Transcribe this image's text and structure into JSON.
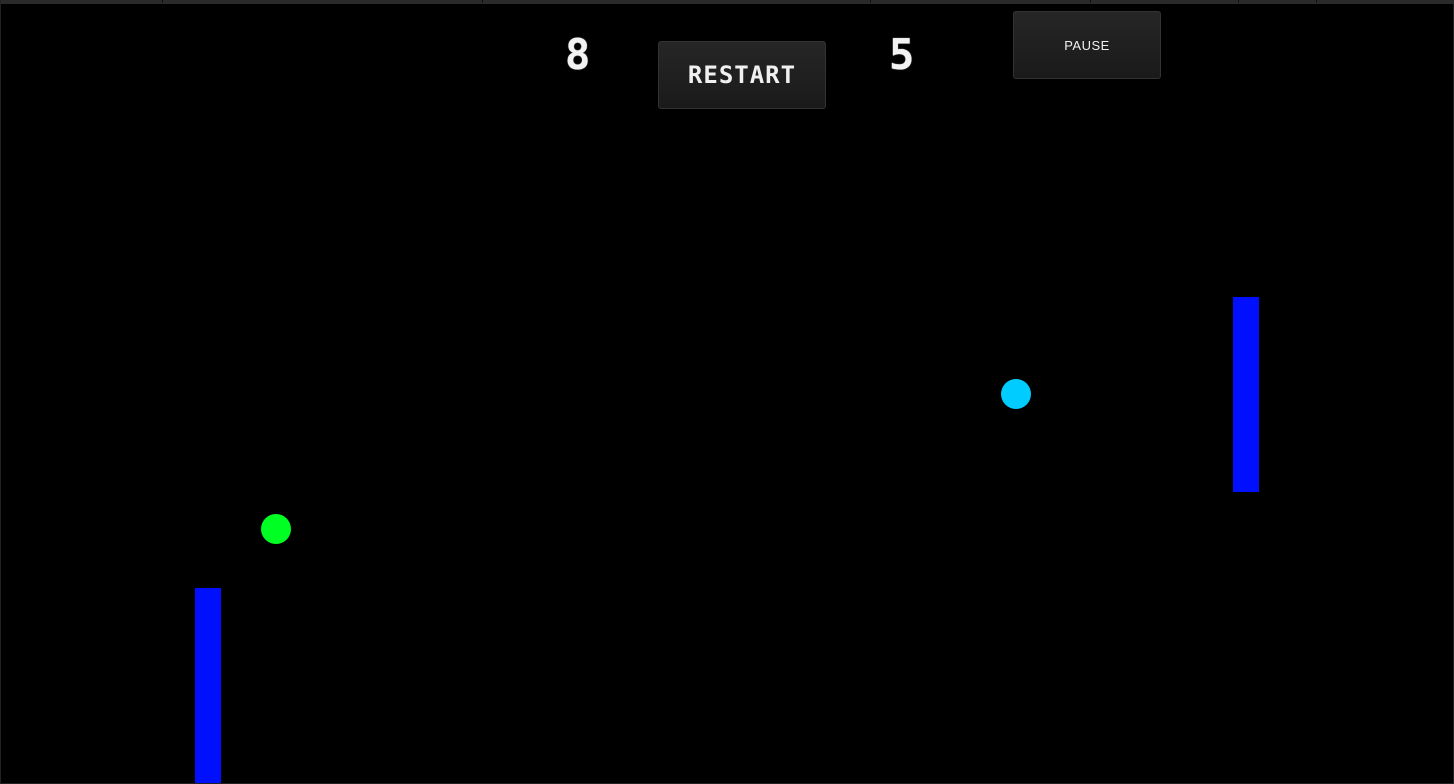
{
  "scores": {
    "left": "8",
    "right": "5"
  },
  "buttons": {
    "restart_label": "RESTART",
    "pause_label": "PAUSE"
  },
  "colors": {
    "background": "#000000",
    "paddle": "#0010ff",
    "ball_green": "#00ff22",
    "ball_cyan": "#00ccff",
    "score_text": "#f2f2f2"
  }
}
